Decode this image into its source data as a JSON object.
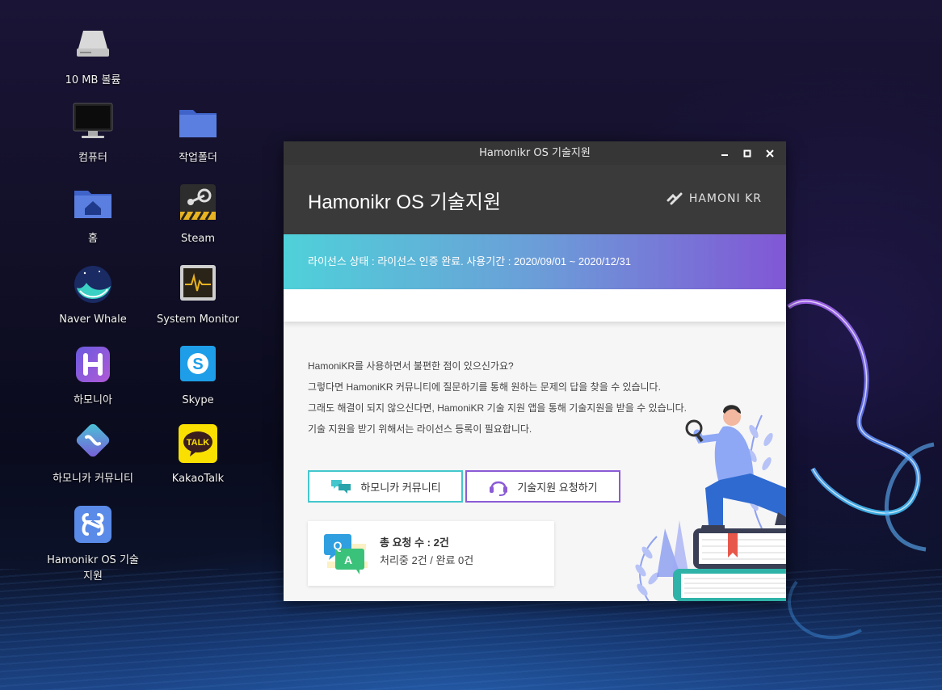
{
  "desktop": {
    "icons": [
      {
        "label": "10 MB 볼륨"
      },
      {
        "label": "컴퓨터"
      },
      {
        "label": "작업폴더"
      },
      {
        "label": "홈"
      },
      {
        "label": "Steam"
      },
      {
        "label": "Naver Whale"
      },
      {
        "label": "System Monitor"
      },
      {
        "label": "하모니아"
      },
      {
        "label": "Skype"
      },
      {
        "label": "하모니카 커뮤니티"
      },
      {
        "label": "KakaoTalk"
      },
      {
        "label": "Hamonikr OS 기술\n지원"
      }
    ]
  },
  "window": {
    "title": "Hamonikr OS 기술지원",
    "header_title": "Hamonikr OS 기술지원",
    "logo_text": "HAMONI KR",
    "license_text": "라이선스 상태 : 라이선스 인증 완료. 사용기간 : 2020/09/01 ~ 2020/12/31",
    "intro_lines": [
      "HamoniKR를 사용하면서 불편한 점이 있으신가요?",
      "그렇다면 HamoniKR 커뮤니티에 질문하기를 통해 원하는 문제의 답을 찾을 수 있습니다.",
      "그래도 해결이 되지 않으신다면, HamoniKR 기술 지원 앱을 통해 기술지원을 받을 수 있습니다.",
      "기술 지원을 받기 위해서는 라이선스 등록이 필요합니다."
    ],
    "buttons": {
      "community": "하모니카 커뮤니티",
      "support": "기술지원 요청하기"
    },
    "stats": {
      "total": "총 요청 수 : 2건",
      "detail": "처리중 2건 / 완료 0건",
      "q": "Q",
      "a": "A"
    }
  },
  "colors": {
    "license_gradient_start": "#4fd1d9",
    "license_gradient_end": "#8157d6",
    "community_border": "#43c7cc",
    "support_border": "#8b5bd6"
  }
}
